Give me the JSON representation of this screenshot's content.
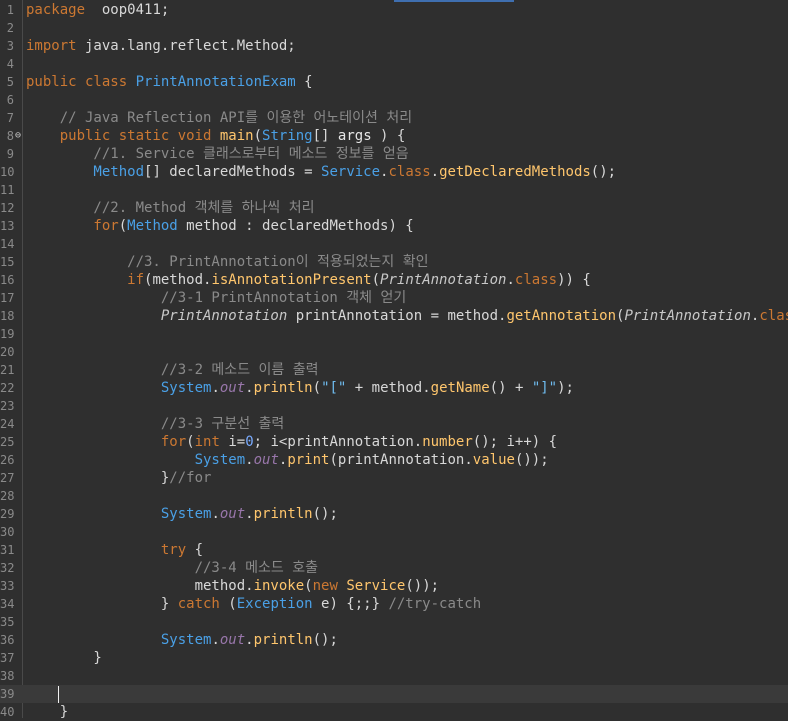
{
  "editor": {
    "language": "java",
    "current_line": "39",
    "colors": {
      "background": "#2f2f2f",
      "keyword": "#cc7832",
      "type": "#4aa0e6",
      "method": "#ffc66d",
      "comment": "#8a8a8a",
      "string": "#6fbcf0"
    },
    "lines": [
      {
        "n": "1",
        "segs": [
          [
            "kw",
            "package"
          ],
          [
            "",
            "  oop0411;"
          ]
        ]
      },
      {
        "n": "2",
        "segs": []
      },
      {
        "n": "3",
        "segs": [
          [
            "kw",
            "import"
          ],
          [
            "",
            " java.lang.reflect.Method;"
          ]
        ]
      },
      {
        "n": "4",
        "segs": []
      },
      {
        "n": "5",
        "segs": [
          [
            "kw",
            "public class"
          ],
          [
            "",
            " "
          ],
          [
            "ty",
            "PrintAnnotationExam"
          ],
          [
            "",
            " {"
          ]
        ]
      },
      {
        "n": "6",
        "segs": []
      },
      {
        "n": "7",
        "segs": [
          [
            "cm",
            "    // Java Reflection API를 이용한 어노테이션 처리"
          ]
        ]
      },
      {
        "n": "8",
        "fold": "⊖",
        "segs": [
          [
            "kw",
            "    public static void "
          ],
          [
            "fn",
            "main"
          ],
          [
            "",
            "("
          ],
          [
            "ty",
            "String"
          ],
          [
            "",
            "[] "
          ],
          [
            "var",
            "args"
          ],
          [
            "",
            " ) {"
          ]
        ]
      },
      {
        "n": "9",
        "segs": [
          [
            "cm",
            "        //1. Service 클래스로부터 메소드 정보를 얻음"
          ]
        ]
      },
      {
        "n": "10",
        "segs": [
          [
            "ty",
            "        Method"
          ],
          [
            "",
            "[] declaredMethods = "
          ],
          [
            "ty",
            "Service"
          ],
          [
            "",
            "."
          ],
          [
            "kw",
            "class"
          ],
          [
            "",
            "."
          ],
          [
            "fn",
            "getDeclaredMethods"
          ],
          [
            "",
            "();"
          ]
        ]
      },
      {
        "n": "11",
        "segs": []
      },
      {
        "n": "12",
        "segs": [
          [
            "cm",
            "        //2. Method 객체를 하나씩 처리"
          ]
        ]
      },
      {
        "n": "13",
        "segs": [
          [
            "kw",
            "        for"
          ],
          [
            "",
            "("
          ],
          [
            "ty",
            "Method"
          ],
          [
            "",
            " method : declaredMethods) {"
          ]
        ]
      },
      {
        "n": "14",
        "segs": []
      },
      {
        "n": "15",
        "segs": [
          [
            "cm",
            "            //3. PrintAnnotation이 적용되었는지 확인"
          ]
        ]
      },
      {
        "n": "16",
        "segs": [
          [
            "kw",
            "            if"
          ],
          [
            "",
            "(method."
          ],
          [
            "fn",
            "isAnnotationPresent"
          ],
          [
            "",
            "("
          ],
          [
            "ita",
            "PrintAnnotation"
          ],
          [
            "",
            "."
          ],
          [
            "kw",
            "class"
          ],
          [
            "",
            ")) {"
          ]
        ]
      },
      {
        "n": "17",
        "segs": [
          [
            "cm",
            "                //3-1 PrintAnnotation 객체 얻기"
          ]
        ]
      },
      {
        "n": "18",
        "segs": [
          [
            "ita",
            "                PrintAnnotation"
          ],
          [
            "",
            " printAnnotation = method."
          ],
          [
            "fn",
            "getAnnotation"
          ],
          [
            "",
            "("
          ],
          [
            "ita",
            "PrintAnnotation"
          ],
          [
            "",
            "."
          ],
          [
            "kw",
            "class"
          ],
          [
            "",
            ");"
          ]
        ]
      },
      {
        "n": "19",
        "segs": []
      },
      {
        "n": "20",
        "segs": []
      },
      {
        "n": "21",
        "segs": [
          [
            "cm",
            "                //3-2 메소드 이름 출력"
          ]
        ]
      },
      {
        "n": "22",
        "segs": [
          [
            "ty",
            "                System"
          ],
          [
            "",
            "."
          ],
          [
            "fld",
            "out"
          ],
          [
            "",
            "."
          ],
          [
            "fn",
            "println"
          ],
          [
            "",
            "("
          ],
          [
            "str",
            "\"[\""
          ],
          [
            "",
            " + method."
          ],
          [
            "fn",
            "getName"
          ],
          [
            "",
            "() + "
          ],
          [
            "str",
            "\"]\""
          ],
          [
            "",
            ");"
          ]
        ]
      },
      {
        "n": "23",
        "segs": []
      },
      {
        "n": "24",
        "segs": [
          [
            "cm",
            "                //3-3 구분선 출력"
          ]
        ]
      },
      {
        "n": "25",
        "segs": [
          [
            "kw",
            "                for"
          ],
          [
            "",
            "("
          ],
          [
            "kw",
            "int"
          ],
          [
            "",
            " i="
          ],
          [
            "num",
            "0"
          ],
          [
            "",
            "; i<printAnnotation."
          ],
          [
            "fn",
            "number"
          ],
          [
            "",
            "(); i++) {"
          ]
        ]
      },
      {
        "n": "26",
        "segs": [
          [
            "ty",
            "                    System"
          ],
          [
            "",
            "."
          ],
          [
            "fld",
            "out"
          ],
          [
            "",
            "."
          ],
          [
            "fn",
            "print"
          ],
          [
            "",
            "(printAnnotation."
          ],
          [
            "fn",
            "value"
          ],
          [
            "",
            "());"
          ]
        ]
      },
      {
        "n": "27",
        "segs": [
          [
            "",
            "                }"
          ],
          [
            "cm",
            "//for"
          ]
        ]
      },
      {
        "n": "28",
        "segs": []
      },
      {
        "n": "29",
        "segs": [
          [
            "ty",
            "                System"
          ],
          [
            "",
            "."
          ],
          [
            "fld",
            "out"
          ],
          [
            "",
            "."
          ],
          [
            "fn",
            "println"
          ],
          [
            "",
            "();"
          ]
        ]
      },
      {
        "n": "30",
        "segs": []
      },
      {
        "n": "31",
        "segs": [
          [
            "kw",
            "                try"
          ],
          [
            "",
            " {"
          ]
        ]
      },
      {
        "n": "32",
        "segs": [
          [
            "cm",
            "                    //3-4 메소드 호출"
          ]
        ]
      },
      {
        "n": "33",
        "segs": [
          [
            "",
            "                    method."
          ],
          [
            "fn",
            "invoke"
          ],
          [
            "",
            "("
          ],
          [
            "kw",
            "new"
          ],
          [
            "",
            " "
          ],
          [
            "fn",
            "Service"
          ],
          [
            "",
            "());"
          ]
        ]
      },
      {
        "n": "34",
        "segs": [
          [
            "",
            "                } "
          ],
          [
            "kw",
            "catch"
          ],
          [
            "",
            " ("
          ],
          [
            "ty",
            "Exception"
          ],
          [
            "",
            " e) {;;} "
          ],
          [
            "cm",
            "//try-catch"
          ]
        ]
      },
      {
        "n": "35",
        "segs": []
      },
      {
        "n": "36",
        "segs": [
          [
            "ty",
            "                System"
          ],
          [
            "",
            "."
          ],
          [
            "fld",
            "out"
          ],
          [
            "",
            "."
          ],
          [
            "fn",
            "println"
          ],
          [
            "",
            "();"
          ]
        ]
      },
      {
        "n": "37",
        "segs": [
          [
            "",
            "        }"
          ]
        ]
      },
      {
        "n": "38",
        "segs": []
      },
      {
        "n": "39",
        "segs": []
      },
      {
        "n": "40",
        "segs": [
          [
            "",
            "    }"
          ]
        ]
      }
    ]
  }
}
